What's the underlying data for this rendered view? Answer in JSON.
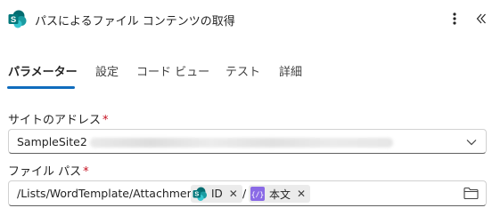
{
  "header": {
    "title": "パスによるファイル コンテンツの取得",
    "app_icon": "sharepoint-icon",
    "more_icon": "more-vertical-icon",
    "collapse_icon": "double-chevron-left-icon"
  },
  "tabs": [
    {
      "label": "パラメーター",
      "active": true
    },
    {
      "label": "設定",
      "active": false
    },
    {
      "label": "コード ビュー",
      "active": false
    },
    {
      "label": "テスト",
      "active": false
    },
    {
      "label": "詳細",
      "active": false
    }
  ],
  "site_address": {
    "label": "サイトのアドレス",
    "required_mark": "*",
    "value": "SampleSite2",
    "chevron_icon": "chevron-down-icon"
  },
  "file_path": {
    "label": "ファイル パス",
    "required_mark": "*",
    "prefix": "/Lists/WordTemplate/Attachments/",
    "separator": "/",
    "tokens": [
      {
        "label": "ID",
        "icon": "sharepoint-icon",
        "remove": "✕"
      },
      {
        "label": "本文",
        "icon": "expression-icon",
        "remove": "✕"
      }
    ],
    "folder_icon": "folder-icon"
  },
  "colors": {
    "accent": "#0f6cbd",
    "sharepoint": "#03787c",
    "expression": "#8a6ae6",
    "required": "#c50f1f"
  }
}
